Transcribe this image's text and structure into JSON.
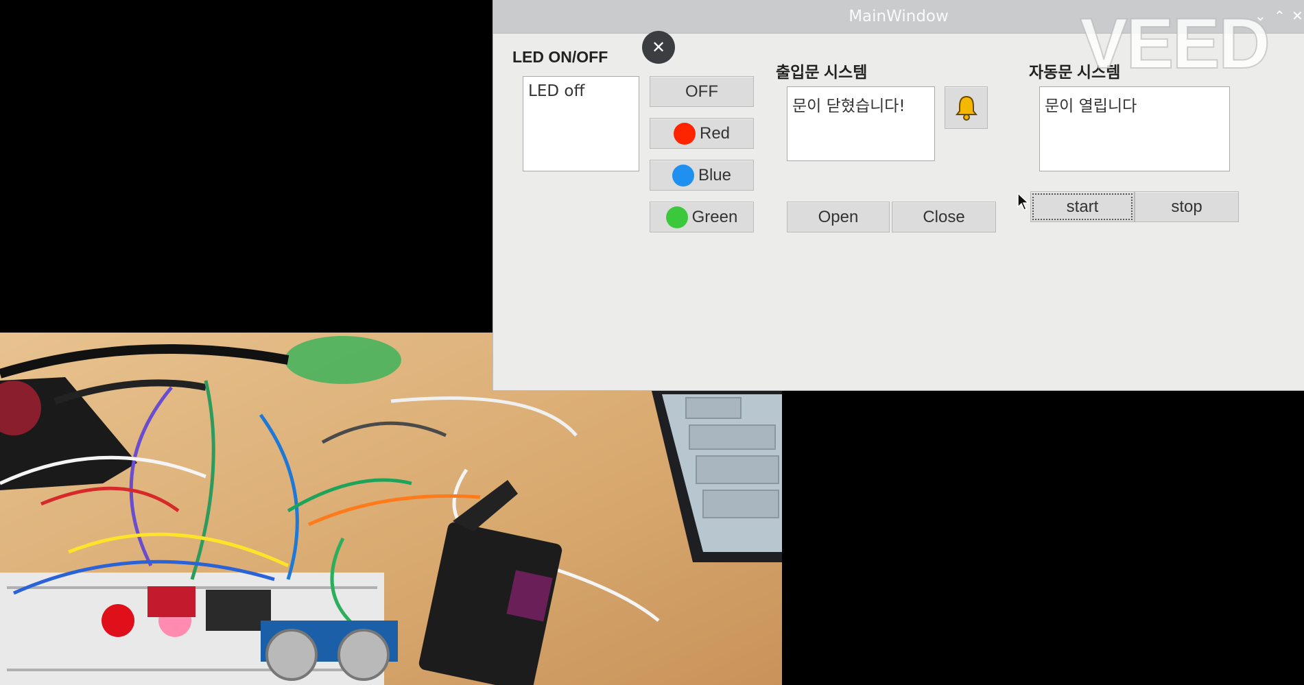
{
  "window": {
    "title": "MainWindow",
    "controls": [
      "⌄",
      "⌃",
      "✕"
    ]
  },
  "led_panel": {
    "label": "LED ON/OFF",
    "status_text": "LED off",
    "buttons": {
      "off": "OFF",
      "red": "Red",
      "blue": "Blue",
      "green": "Green"
    },
    "colors": {
      "red": "#ff2400",
      "blue": "#1f8ff0",
      "green": "#3cc83c"
    }
  },
  "door_panel": {
    "label": "출입문 시스템",
    "status_text": "문이 닫혔습니다!",
    "bell_icon": "bell-icon",
    "buttons": {
      "open": "Open",
      "close": "Close"
    }
  },
  "auto_panel": {
    "label": "자동문 시스템",
    "status_text": "문이 열립니다",
    "buttons": {
      "start": "start",
      "stop": "stop"
    }
  },
  "overlay": {
    "close_glyph": "✕",
    "watermark": "VEED"
  }
}
